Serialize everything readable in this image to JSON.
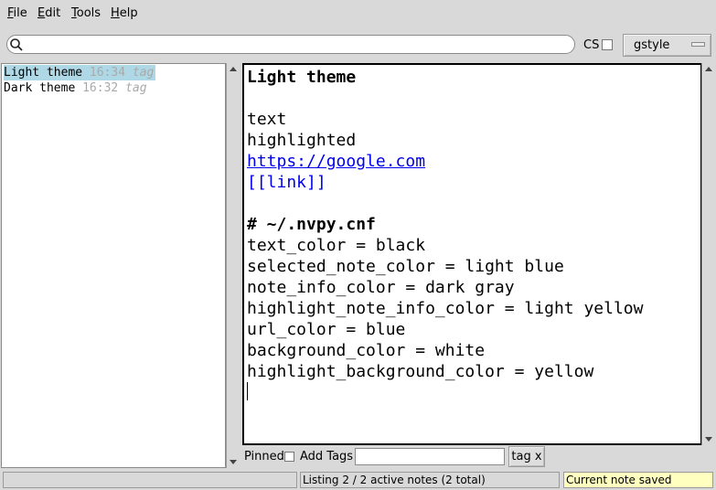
{
  "menubar": {
    "items": [
      {
        "underline": "F",
        "rest": "ile"
      },
      {
        "underline": "E",
        "rest": "dit"
      },
      {
        "underline": "T",
        "rest": "ools"
      },
      {
        "underline": "H",
        "rest": "elp"
      }
    ]
  },
  "search": {
    "value": "",
    "icon": "search-icon",
    "case_sensitive_label": "CS",
    "case_sensitive_checked": false,
    "search_mode": "gstyle"
  },
  "notes": [
    {
      "title": "Light theme",
      "time": "16:34",
      "tag": "tag",
      "selected": true
    },
    {
      "title": "Dark theme",
      "time": "16:32",
      "tag": "tag",
      "selected": false
    }
  ],
  "editor": {
    "lines": [
      {
        "text": "Light theme",
        "style": "bold"
      },
      {
        "text": "",
        "style": "plain"
      },
      {
        "text": "text",
        "style": "plain"
      },
      {
        "text": "highlighted",
        "style": "plain"
      },
      {
        "text": "https://google.com",
        "style": "url"
      },
      {
        "text": "[[link]]",
        "style": "link"
      },
      {
        "text": "",
        "style": "plain"
      },
      {
        "text": "# ~/.nvpy.cnf",
        "style": "bold"
      },
      {
        "text": "text_color = black",
        "style": "plain"
      },
      {
        "text": "selected_note_color = light blue",
        "style": "plain"
      },
      {
        "text": "note_info_color = dark gray",
        "style": "plain"
      },
      {
        "text": "highlight_note_info_color = light yellow",
        "style": "plain"
      },
      {
        "text": "url_color = blue",
        "style": "plain"
      },
      {
        "text": "background_color = white",
        "style": "plain"
      },
      {
        "text": "highlight_background_color = yellow",
        "style": "plain"
      }
    ]
  },
  "tag_bar": {
    "pinned_label": "Pinned",
    "pinned_checked": false,
    "add_tags_label": "Add Tags",
    "add_tags_value": "",
    "tag_button_label": "tag x"
  },
  "status_bar": {
    "left": "",
    "middle": "Listing 2 / 2 active notes (2 total)",
    "right": "Current note saved"
  },
  "colors": {
    "selected_note": "#aed8e6",
    "note_info": "#a9a9a9",
    "url": "#0000ee",
    "status_highlight": "#ffffc0"
  }
}
